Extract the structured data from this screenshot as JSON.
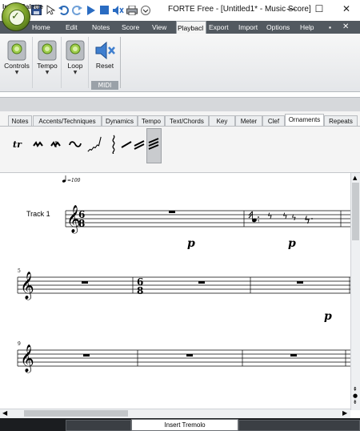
{
  "window": {
    "title": "FORTE Free - [Untitled1* - Music Score]",
    "minimize_glyph": "—",
    "maximize_glyph": "☐",
    "close_glyph": "✕"
  },
  "quick_access": [
    "save-icon",
    "pointer-icon",
    "undo-icon",
    "redo-icon",
    "play-icon",
    "stop-icon",
    "mute-icon",
    "print-icon",
    "customize-icon"
  ],
  "ribbon_tabs": [
    {
      "label": "Home"
    },
    {
      "label": "Edit"
    },
    {
      "label": "Notes"
    },
    {
      "label": "Score"
    },
    {
      "label": "View"
    },
    {
      "label": "Playbacl",
      "active": true
    },
    {
      "label": "Export"
    },
    {
      "label": "Import"
    },
    {
      "label": "Options"
    },
    {
      "label": "Help"
    }
  ],
  "ribbon": {
    "controls_label": "Controls",
    "tempo_label": "Tempo",
    "loop_label": "Loop",
    "reset_label": "Reset",
    "midi_group_label": "MIDI"
  },
  "palette": {
    "title": "Input Palette",
    "tabs": [
      {
        "label": "Notes"
      },
      {
        "label": "Accents/Techniques"
      },
      {
        "label": "Dynamics"
      },
      {
        "label": "Tempo"
      },
      {
        "label": "Text/Chords"
      },
      {
        "label": "Key"
      },
      {
        "label": "Meter"
      },
      {
        "label": "Clef"
      },
      {
        "label": "Ornaments",
        "active": true
      },
      {
        "label": "Repeats"
      }
    ],
    "ornaments": [
      {
        "name": "trill-icon",
        "glyph": "tr"
      },
      {
        "name": "mordent-icon",
        "glyph": "∿"
      },
      {
        "name": "inverted-mordent-icon",
        "glyph": "∿"
      },
      {
        "name": "turn-icon",
        "glyph": "∾"
      },
      {
        "name": "glissando-icon",
        "glyph": "⟋"
      },
      {
        "name": "arpeggio-icon",
        "glyph": "≀"
      },
      {
        "name": "slash-tremolo-1-icon",
        "glyph": "/"
      },
      {
        "name": "slash-tremolo-2-icon",
        "glyph": "//"
      },
      {
        "name": "slash-tremolo-3-icon",
        "glyph": "///"
      }
    ]
  },
  "score": {
    "tempo_marking": "♩=100",
    "track_label": "Track 1",
    "time_signature": {
      "top": "6",
      "bottom": "8"
    },
    "measure_numbers": [
      "5",
      "9"
    ],
    "dynamics": [
      "p",
      "p",
      "p"
    ]
  },
  "status": {
    "message": "Insert Tremolo"
  },
  "colors": {
    "tab_bar": "#525960",
    "status_bar": "#1b1d20",
    "accent_green": "#7fa52a"
  }
}
